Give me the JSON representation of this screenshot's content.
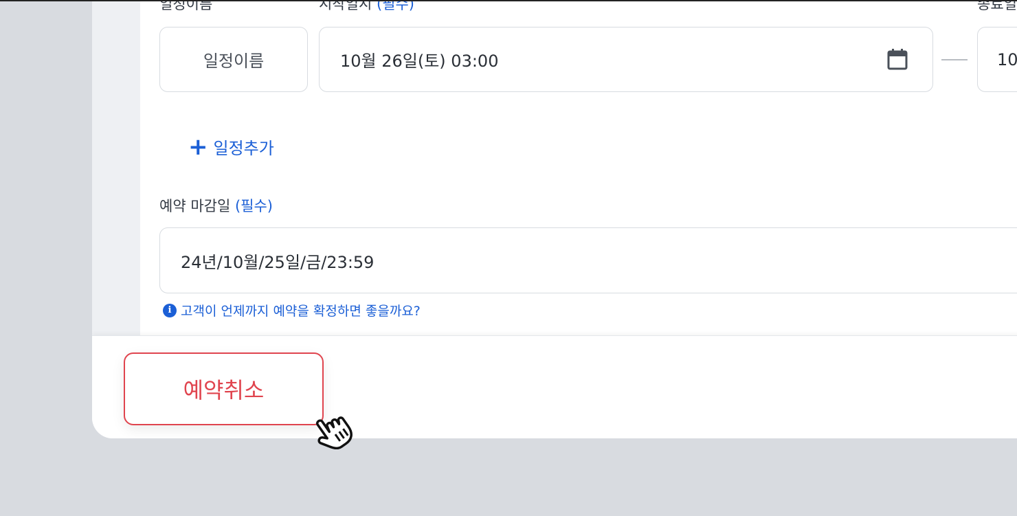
{
  "schedule": {
    "name_label": "일정이름",
    "start_label": "시작일시",
    "start_required": "(필수)",
    "end_label": "종료일시",
    "name_placeholder": "일정이름",
    "start_value": "10월 26일(토) 03:00",
    "end_value_partial": "10",
    "add_button": "일정추가"
  },
  "deadline": {
    "label": "예약 마감일",
    "required": "(필수)",
    "value": "24년/10월/25일/금/23:59",
    "hint": "고객이 언제까지 예약을 확정하면 좋을까요?"
  },
  "footer": {
    "cancel_button": "예약취소"
  },
  "icons": {
    "calendar": "calendar-icon",
    "plus": "plus-icon",
    "info": "info-icon",
    "cursor": "hand-pointer-cursor-icon"
  },
  "colors": {
    "accent": "#1b5fd6",
    "danger": "#e0444e",
    "background": "#d8dbe0"
  }
}
